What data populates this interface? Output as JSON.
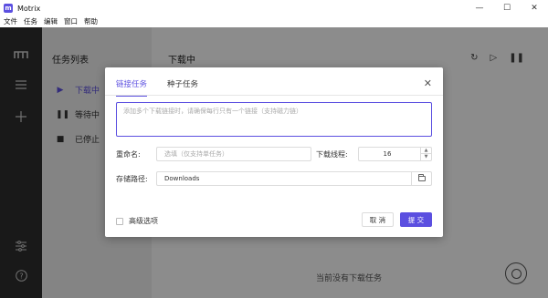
{
  "window": {
    "title": "Motrix",
    "app_icon_glyph": "m",
    "controls": [
      "minimize",
      "maximize",
      "close"
    ]
  },
  "menubar": [
    "文件",
    "任务",
    "编辑",
    "窗口",
    "帮助"
  ],
  "tasks": {
    "title": "任务列表",
    "items": [
      {
        "label": "下载中",
        "icon": "play-icon",
        "active": true
      },
      {
        "label": "等待中",
        "icon": "pause-icon",
        "active": false
      },
      {
        "label": "已停止",
        "icon": "stop-icon",
        "active": false
      }
    ]
  },
  "main": {
    "title": "下载中",
    "empty_text": "当前没有下载任务"
  },
  "dialog": {
    "tabs": [
      {
        "label": "链接任务",
        "active": true
      },
      {
        "label": "种子任务",
        "active": false
      }
    ],
    "url_placeholder": "添加多个下载链接时，请确保每行只有一个链接（支持磁力链）",
    "rename_label": "重命名:",
    "rename_placeholder": "选填（仅支持单任务）",
    "threads_label": "下载线程:",
    "threads_value": "16",
    "path_label": "存储路径:",
    "path_value": "Downloads",
    "advanced_label": "高级选项",
    "cancel_label": "取 消",
    "submit_label": "提 交"
  },
  "colors": {
    "accent": "#5b4fe0",
    "nav_bg": "#2f2f2f",
    "tasks_bg": "#f0f0f0"
  }
}
